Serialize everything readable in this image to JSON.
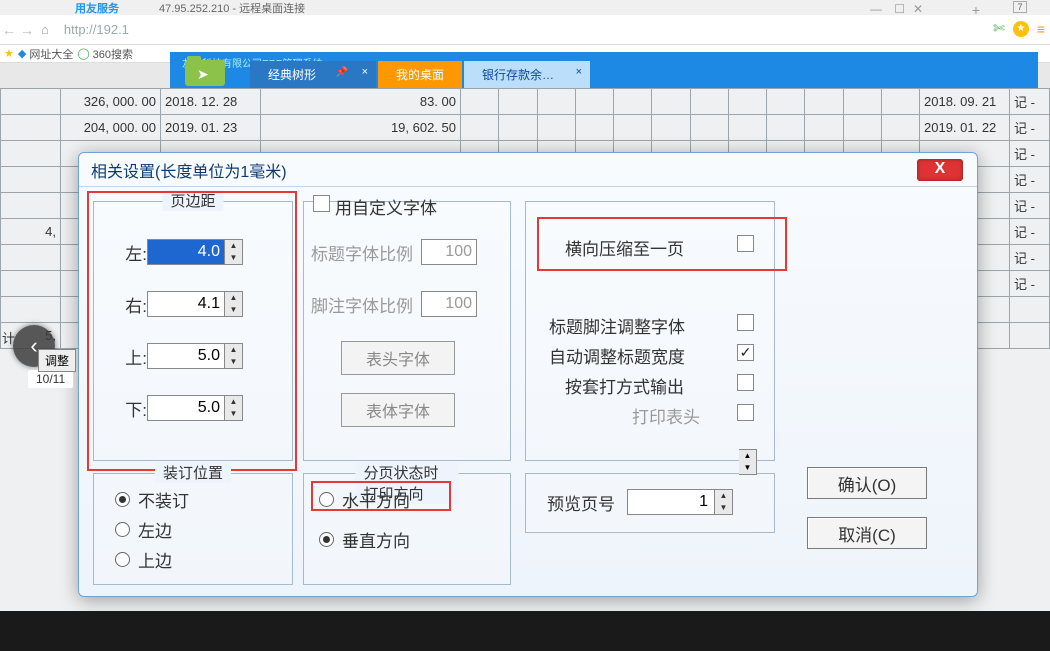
{
  "taskbar": {
    "tab1": "用友服务",
    "tab2": "47.95.252.210 - 远程桌面连接",
    "plus": "+",
    "seven": "7"
  },
  "addr": {
    "back": "←",
    "fwd": "→",
    "home": "⌂",
    "url": "http://192.1"
  },
  "bookmarks": {
    "favstar": "★",
    "item1": "网址大全",
    "item2": "360搜索"
  },
  "app": {
    "title_strip": "友好科技有限公司ERP管理系统",
    "tab_classic": "经典树形",
    "tab_desktop": "我的桌面",
    "tab_bank": "银行存款余…"
  },
  "sheet": {
    "rows": [
      {
        "amt": "326, 000. 00",
        "d1": "2018. 12. 28",
        "v": "83. 00",
        "d2": "2018. 09. 21",
        "note": "记 -"
      },
      {
        "amt": "204, 000. 00",
        "d1": "2019. 01. 23",
        "v": "19, 602. 50",
        "d2": "2019. 01. 22",
        "note": "记 -"
      }
    ],
    "extra_notes": [
      "记 -",
      "记 -",
      "记 -",
      "记 -",
      "记 -",
      "记 -"
    ],
    "left_val_1": "4,",
    "left_label": "计",
    "left_val_2": "5,",
    "left_btn": "调整"
  },
  "dialog": {
    "title": "相关设置(长度单位为1毫米)",
    "close_x": "X",
    "margins_legend": "页边距",
    "left_lbl": "左:",
    "left_val": "4.0",
    "right_lbl": "右:",
    "right_val": "4.1",
    "top_lbl": "上:",
    "top_val": "5.0",
    "bottom_lbl": "下:",
    "bottom_val": "5.0",
    "custom_font_lbl": "用自定义字体",
    "title_ratio_lbl": "标题字体比例",
    "title_ratio_val": "100",
    "foot_ratio_lbl": "脚注字体比例",
    "foot_ratio_val": "100",
    "header_font_btn": "表头字体",
    "body_font_btn": "表体字体",
    "fit_horiz_lbl": "横向压缩至一页",
    "adj_title_foot_lbl": "标题脚注调整字体",
    "auto_title_width_lbl": "自动调整标题宽度",
    "set_output_lbl": "按套打方式输出",
    "print_header_lbl": "打印表头",
    "auto_title_width_chk": "✓",
    "bind_legend": "装订位置",
    "bind_none": "不装订",
    "bind_left": "左边",
    "bind_top": "上边",
    "orient_legend": "分页状态时打印方向",
    "orient_h": "水平方向",
    "orient_v": "垂直方向",
    "preview_lbl": "预览页号",
    "preview_val": "1",
    "ok_btn": "确认(O)",
    "cancel_btn": "取消(C)"
  },
  "gallery": {
    "count": "10/11",
    "arrow": "‹"
  }
}
